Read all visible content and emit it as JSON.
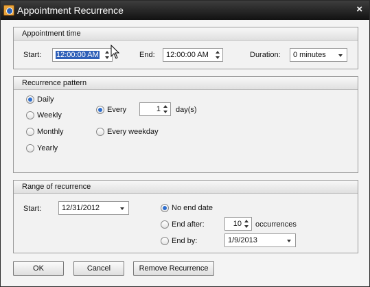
{
  "window": {
    "title": "Appointment Recurrence",
    "close_glyph": "×"
  },
  "appointment_time": {
    "header": "Appointment time",
    "start_label": "Start:",
    "start_value": "12:00:00 AM",
    "end_label": "End:",
    "end_value": "12:00:00 AM",
    "duration_label": "Duration:",
    "duration_value": "0 minutes"
  },
  "recurrence_pattern": {
    "header": "Recurrence pattern",
    "options": [
      "Daily",
      "Weekly",
      "Monthly",
      "Yearly"
    ],
    "selected": "Daily",
    "every_label": "Every",
    "every_value": "1",
    "days_suffix": "day(s)",
    "every_weekday_label": "Every weekday"
  },
  "range": {
    "header": "Range of recurrence",
    "start_label": "Start:",
    "start_value": "12/31/2012",
    "no_end_label": "No end date",
    "end_after_label": "End after:",
    "end_after_value": "10",
    "occurrences_label": "occurrences",
    "end_by_label": "End by:",
    "end_by_value": "1/9/2013"
  },
  "buttons": {
    "ok": "OK",
    "cancel": "Cancel",
    "remove": "Remove Recurrence"
  }
}
